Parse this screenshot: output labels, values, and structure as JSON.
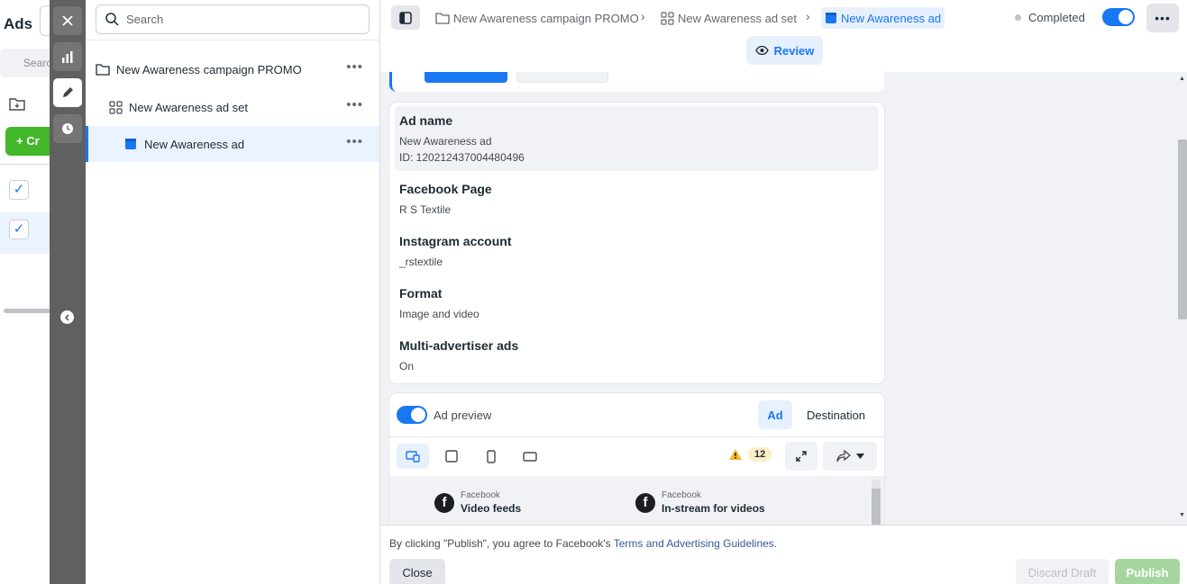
{
  "background_app": {
    "title": "Ads",
    "search_placeholder": "Search",
    "create_label": "Cr"
  },
  "tree": {
    "search_placeholder": "Search",
    "items": [
      {
        "label": "New Awareness campaign PROMO",
        "icon": "folder-icon"
      },
      {
        "label": "New Awareness ad set",
        "icon": "grid-icon"
      },
      {
        "label": "New Awareness ad",
        "icon": "ad-icon"
      }
    ],
    "more_label": "•••"
  },
  "header": {
    "breadcrumbs": [
      {
        "label": "New Awareness campaign PROMO",
        "icon": "folder-icon"
      },
      {
        "label": "New Awareness ad set",
        "icon": "grid-icon"
      },
      {
        "label": "New Awareness ad",
        "icon": "ad-icon",
        "current": true
      }
    ],
    "separator": "›",
    "status": "Completed",
    "more_label": "•••",
    "review_label": "Review"
  },
  "details": {
    "ad_name": {
      "label": "Ad name",
      "value": "New Awareness ad",
      "id_line": "ID: 120212437004480496"
    },
    "facebook_page": {
      "label": "Facebook Page",
      "value": "R S Textile"
    },
    "instagram_account": {
      "label": "Instagram account",
      "value": "_rstextile"
    },
    "format": {
      "label": "Format",
      "value": "Image and video"
    },
    "multi_advertiser": {
      "label": "Multi-advertiser ads",
      "value": "On"
    }
  },
  "preview": {
    "toggle_label": "Ad preview",
    "tab_ad": "Ad",
    "tab_destination": "Destination",
    "warning_count": "12",
    "placements": [
      {
        "source": "Facebook",
        "name": "Video feeds"
      },
      {
        "source": "Facebook",
        "name": "In-stream for videos"
      }
    ]
  },
  "footer": {
    "terms_prefix": "By clicking \"Publish\", you agree to Facebook's ",
    "terms_link": "Terms and Advertising Guidelines",
    "terms_suffix": ".",
    "close_label": "Close",
    "discard_label": "Discard Draft",
    "publish_label": "Publish"
  },
  "colors": {
    "accent": "#1877f2",
    "rail": "#606060",
    "publish_disabled": "#a6d6a0",
    "create_green": "#42b72a"
  }
}
